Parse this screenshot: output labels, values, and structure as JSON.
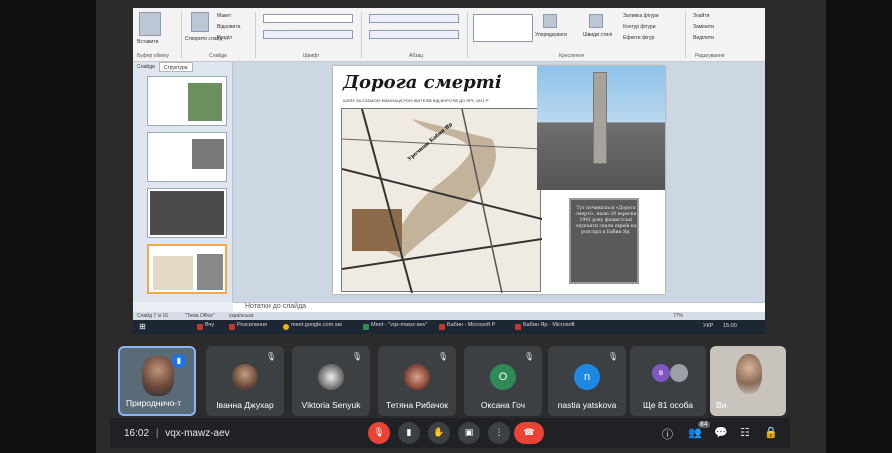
{
  "ppt": {
    "ribbon": {
      "buttons": [
        "Вставити",
        "Створити слайд",
        "Макет",
        "Відновити",
        "Розділ",
        "Упорядкувати",
        "Швидкі стилі",
        "Заливка фігури",
        "Контур фігури",
        "Ефекти фігур",
        "Знайти",
        "Замінити",
        "Виділити"
      ],
      "groups": [
        "Буфер обміну",
        "Слайди",
        "Шрифт",
        "Абзац",
        "Креслення",
        "Редагування"
      ]
    },
    "thumb_tabs": [
      "Слайди",
      "Структура"
    ],
    "thumb_numbers": [
      "5",
      "6",
      "7",
      "8"
    ],
    "slide": {
      "title": "Дорога смерті",
      "subtitle": "ШЛЯХ ЗА СХЕМОЮ ЕВАКУАЦІЇ РОЛІ ЖИТЕЛІВ ВІД ВОРОТІВ ДО ЯРУ, 1941 Р",
      "map_label": "Урочище Бабин Яр",
      "plaque_text": "Тут починалася «Дорога смерті», якою 29 вересня 1941 року фашистські окупанти гнали євреїв на розстріл в Бабин Яр."
    },
    "notes_placeholder": "Нотатки до слайда",
    "status": {
      "slide": "Слайд 7 із 16",
      "theme": "\"Тема Office\"",
      "lang": "українська",
      "zoom": "77%"
    }
  },
  "taskbar": {
    "items": [
      "Вчу",
      "Розсилання",
      "meet.google.com sai",
      "Meet - \"vqx-mawz-aev\"",
      "Бабин - Microsoft P",
      "Бабин Яр - Microsoft"
    ],
    "lang": "УКР",
    "clock": "15:00"
  },
  "meet": {
    "participants": [
      {
        "name": "Природничо-т",
        "type": "video"
      },
      {
        "name": "Іванна Джухар",
        "type": "photo"
      },
      {
        "name": "Viktoria Senyuk",
        "type": "photo"
      },
      {
        "name": "Тетяна Рибачок",
        "type": "photo"
      },
      {
        "name": "Оксана Гоч",
        "type": "letter",
        "letter": "O",
        "color": "#2e8b57"
      },
      {
        "name": "nastia yatskova",
        "type": "letter",
        "letter": "n",
        "color": "#1e88e5"
      },
      {
        "name": "Ще 81 особа",
        "type": "group",
        "letter": "в",
        "color": "#7e57c2"
      },
      {
        "name": "Ви",
        "type": "video"
      }
    ],
    "time": "16:02",
    "meeting_code": "vqx-mawz-aev",
    "participants_badge": "84",
    "colors": {
      "hangup": "#ea4335",
      "mic_off": "#ea4335",
      "bar": "#202124"
    }
  }
}
